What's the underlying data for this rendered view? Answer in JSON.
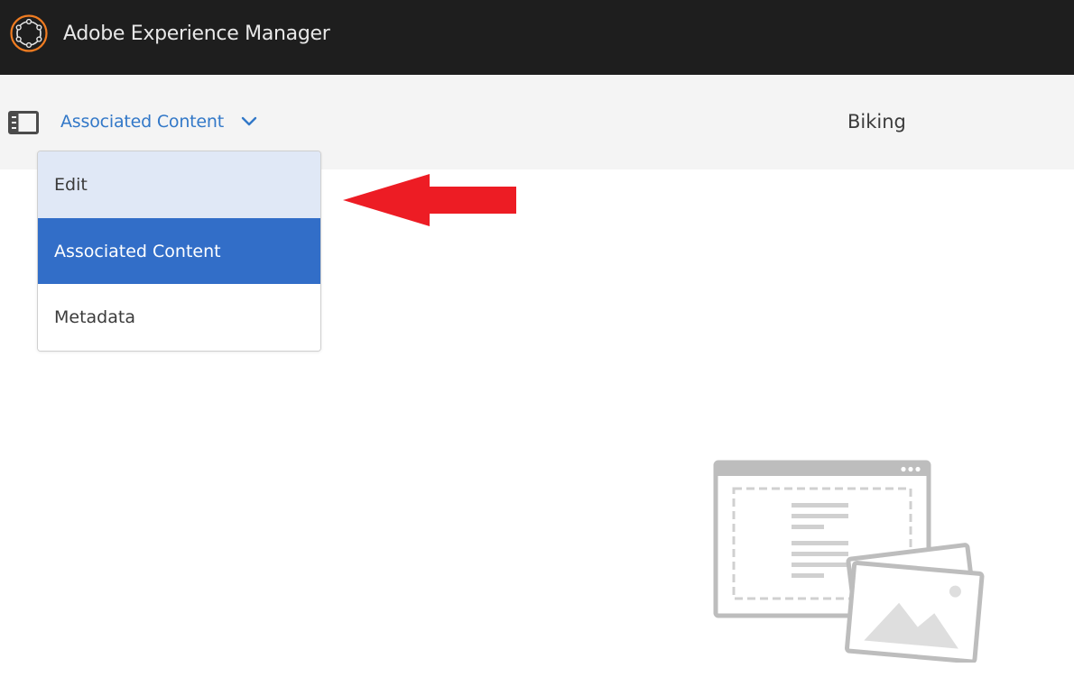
{
  "header": {
    "app_title": "Adobe Experience Manager",
    "logo_icon": "adobe-experience-cloud-logo"
  },
  "toolbar": {
    "rail_toggle_icon": "rail-toggle-icon",
    "view_label": "Associated Content",
    "view_chevron_icon": "chevron-down-icon",
    "page_title": "Biking"
  },
  "view_menu": {
    "items": [
      {
        "label": "Edit",
        "state": "hover"
      },
      {
        "label": "Associated Content",
        "state": "selected"
      },
      {
        "label": "Metadata",
        "state": "default"
      }
    ]
  },
  "annotation": {
    "arrow_icon": "red-arrow-left-icon",
    "arrow_color": "#ed1c24"
  },
  "empty_state": {
    "illustration_icon": "empty-page-with-images-illustration"
  },
  "colors": {
    "topbar_bg": "#1e1e1e",
    "accent_orange": "#f07c21",
    "link_blue": "#3278c8",
    "selected_blue": "#326ec8",
    "hover_blue_light": "#e0e8f6",
    "actionbar_bg": "#f4f4f4"
  }
}
